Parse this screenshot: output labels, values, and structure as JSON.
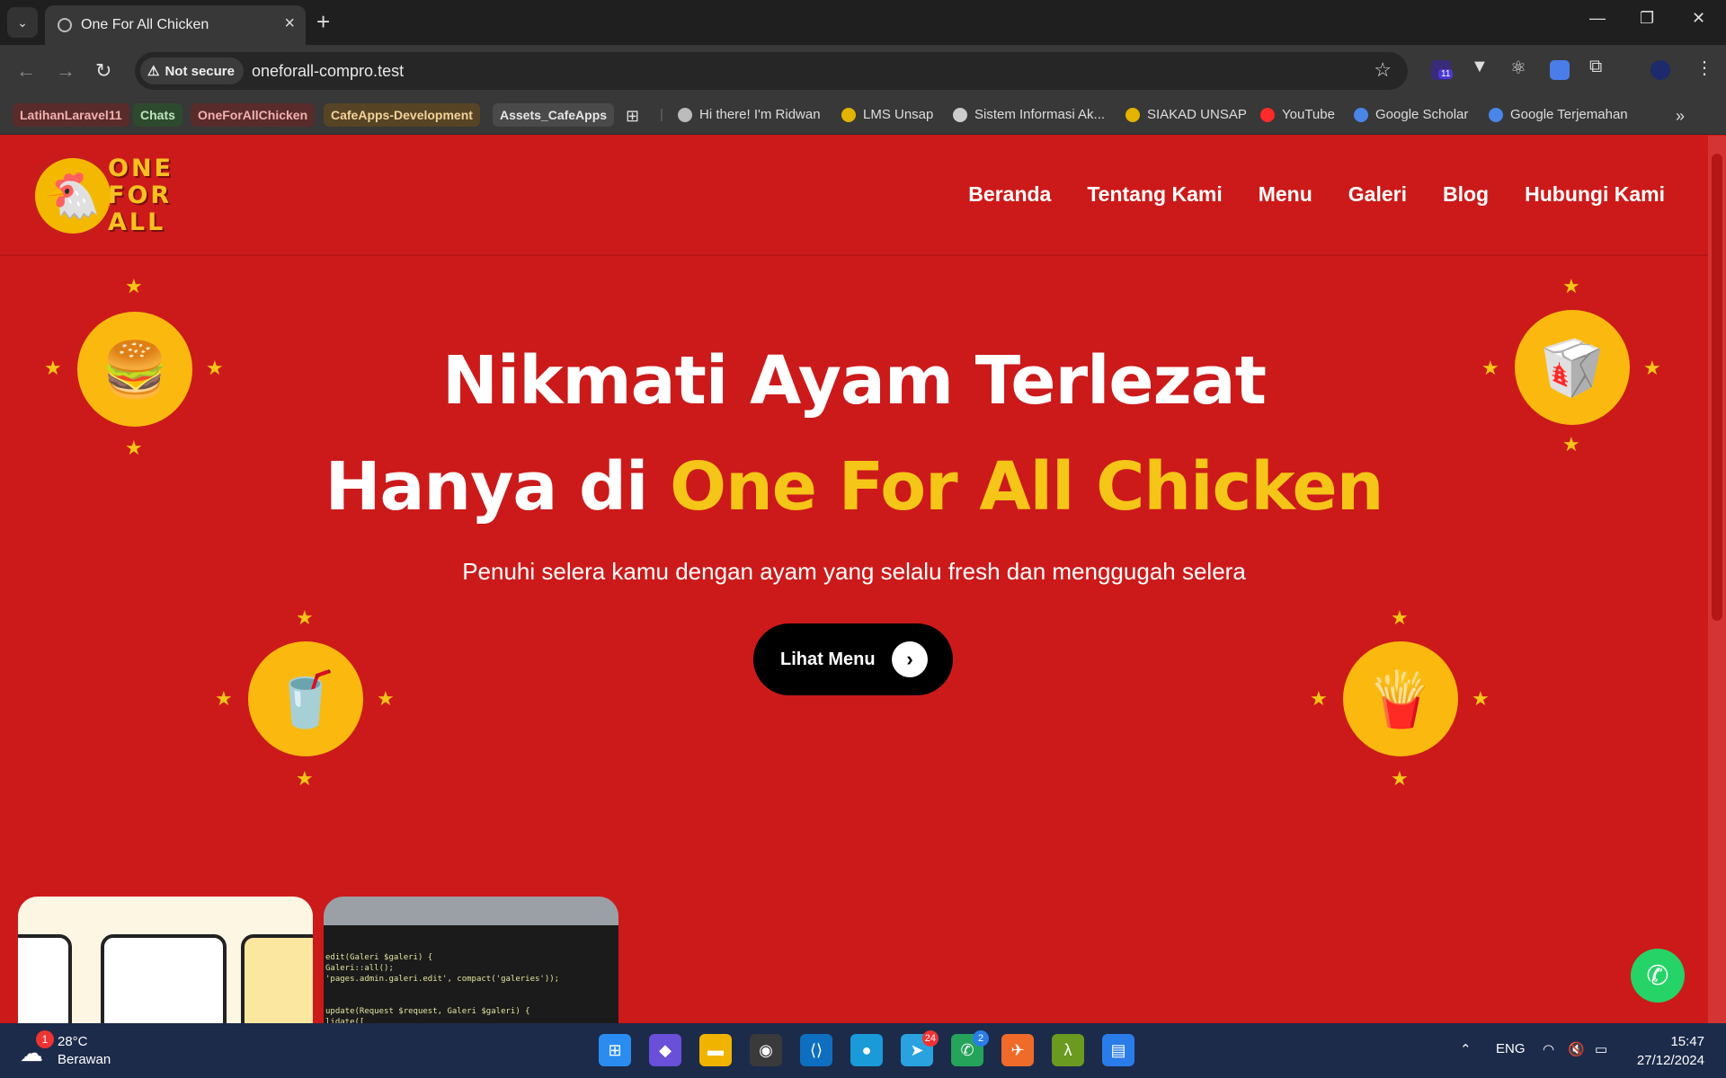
{
  "browser": {
    "tab_title": "One For All Chicken",
    "new_tab": "+",
    "not_secure": "Not secure",
    "url": "oneforall-compro.test",
    "ext_badge": "11",
    "bookmark_chips": [
      {
        "label": "LatihanLaravel11",
        "bg": "#5a2b2b",
        "fg": "#f3b0b0"
      },
      {
        "label": "Chats",
        "bg": "#2e4a2e",
        "fg": "#bde6bd"
      },
      {
        "label": "OneForAllChicken",
        "bg": "#5a2b2b",
        "fg": "#f3b0b0"
      },
      {
        "label": "CafeApps-Development",
        "bg": "#574425",
        "fg": "#f3d39a"
      },
      {
        "label": "Assets_CafeApps",
        "bg": "#4a4a4a",
        "fg": "#e6e6e6"
      }
    ],
    "bookmarks": [
      {
        "label": "Hi there! I'm Ridwan",
        "color": "#bbbbbb"
      },
      {
        "label": "LMS Unsap",
        "color": "#e2b400"
      },
      {
        "label": "Sistem Informasi Ak...",
        "color": "#cccccc"
      },
      {
        "label": "SIAKAD UNSAP",
        "color": "#e2b400"
      },
      {
        "label": "YouTube",
        "color": "#ff2a2a"
      },
      {
        "label": "Google Scholar",
        "color": "#4a86e8"
      },
      {
        "label": "Google Terjemahan",
        "color": "#4a86e8"
      }
    ]
  },
  "site": {
    "logo_lines": [
      "ONE",
      "FOR",
      "ALL"
    ],
    "nav": [
      "Beranda",
      "Tentang Kami",
      "Menu",
      "Galeri",
      "Blog",
      "Hubungi Kami"
    ],
    "hero": {
      "line1": "Nikmati Ayam Terlezat",
      "line2_prefix": "Hanya di ",
      "line2_accent": "One For All Chicken",
      "subtitle": "Penuhi selera kamu dengan ayam yang selalu fresh dan menggugah selera",
      "cta": "Lihat Menu"
    },
    "code_snippet": "edit(Galeri $galeri) {\nGaleri::all();\n'pages.admin.galeri.edit', compact('galeries'));\n\n\nupdate(Request $request, Galeri $galeri) {\nlidate(["
  },
  "taskbar": {
    "temperature": "28°C",
    "weather": "Berawan",
    "weather_badge": "1",
    "telegram_badge": "24",
    "whatsapp_badge": "2",
    "language": "ENG",
    "time": "15:47",
    "date": "27/12/2024"
  },
  "colors": {
    "brand_red": "#cc1a1a",
    "accent_yellow": "#f5c518",
    "icon_circle": "#fbb90f",
    "whatsapp": "#25d366"
  }
}
